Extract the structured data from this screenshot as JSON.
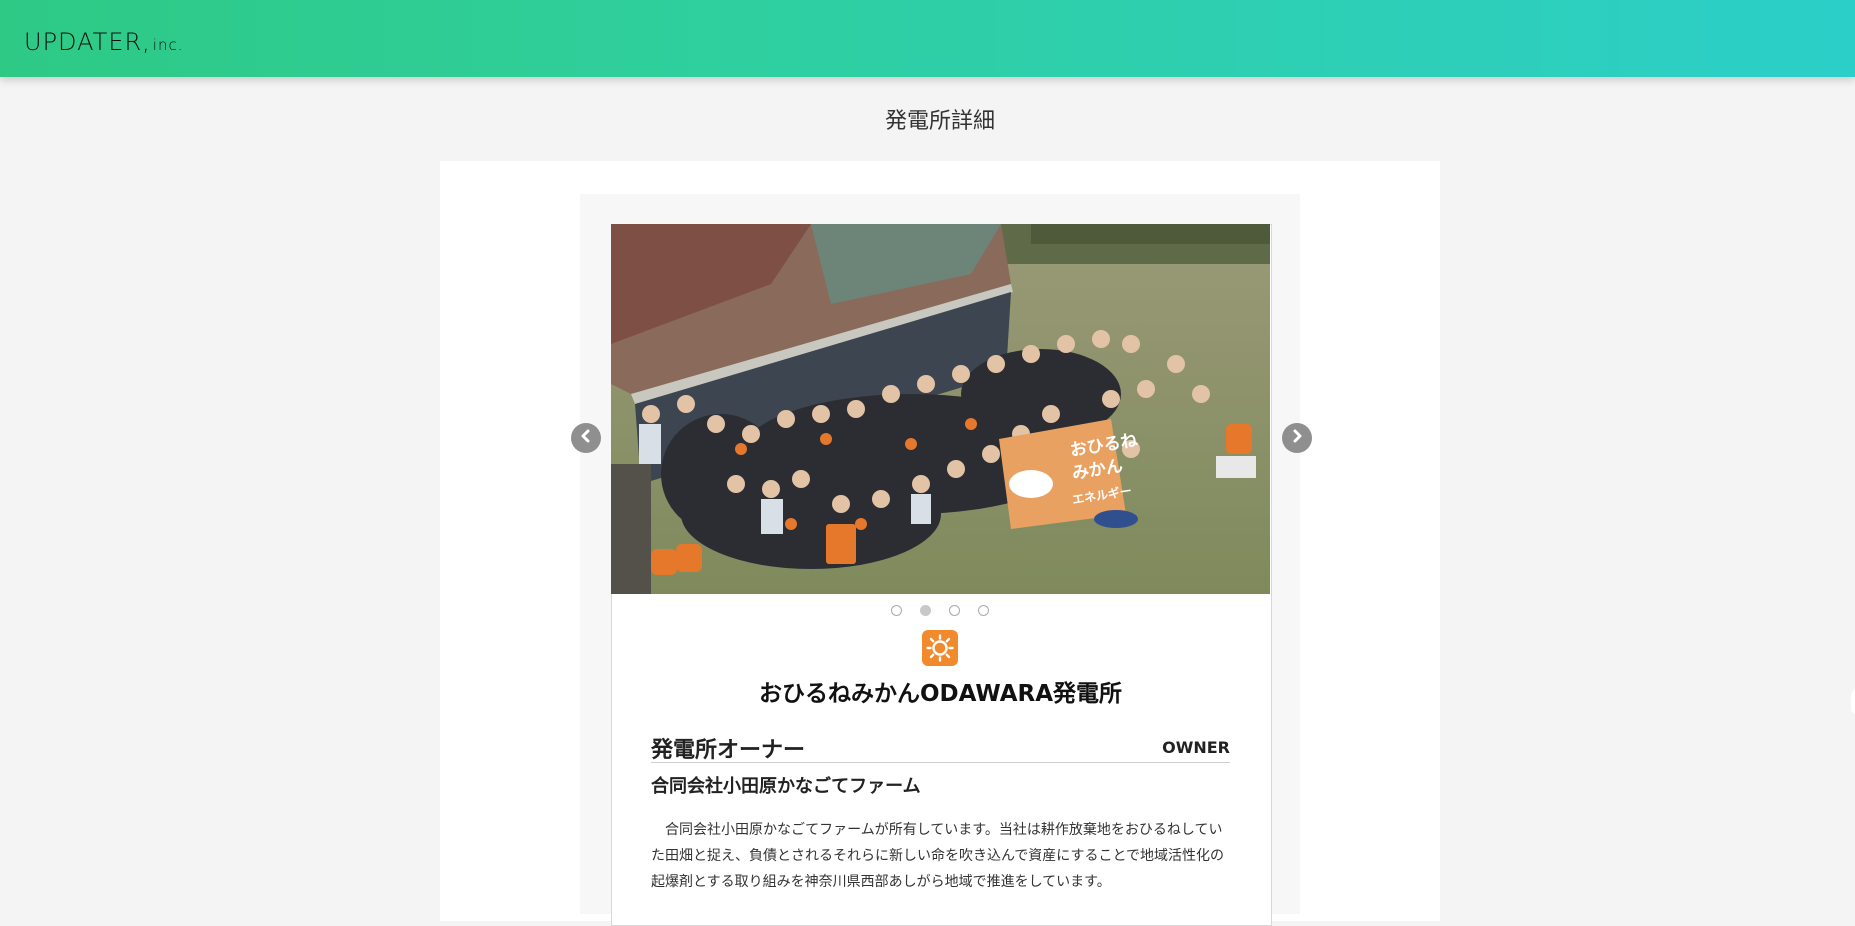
{
  "header": {
    "logo_main": "UPDATER,",
    "logo_sub": "inc."
  },
  "page": {
    "title": "発電所詳細"
  },
  "carousel": {
    "prev_icon": "chevron-left-icon",
    "next_icon": "chevron-right-icon",
    "slide_count": 4,
    "active_index": 1,
    "banner_text": [
      "おひるね",
      "みかん",
      "エネルギー"
    ]
  },
  "plant": {
    "type_icon": "sun-icon",
    "type_color": "#f18a2c",
    "name": "おひるねみかんODAWARA発電所"
  },
  "owner": {
    "section_title": "発電所オーナー",
    "section_label_en": "OWNER",
    "name": "合同会社小田原かなごてファーム",
    "description": "合同会社小田原かなごてファームが所有しています。当社は耕作放棄地をおひるねしていた田畑と捉え、負債とされるそれらに新しい命を吹き込んで資産にすることで地域活性化の起爆剤とする取り組みを神奈川県西部あしがら地域で推進をしています。"
  },
  "colors": {
    "header_start": "#2ec985",
    "header_end": "#2ccfc8",
    "accent_orange": "#f18a2c"
  }
}
